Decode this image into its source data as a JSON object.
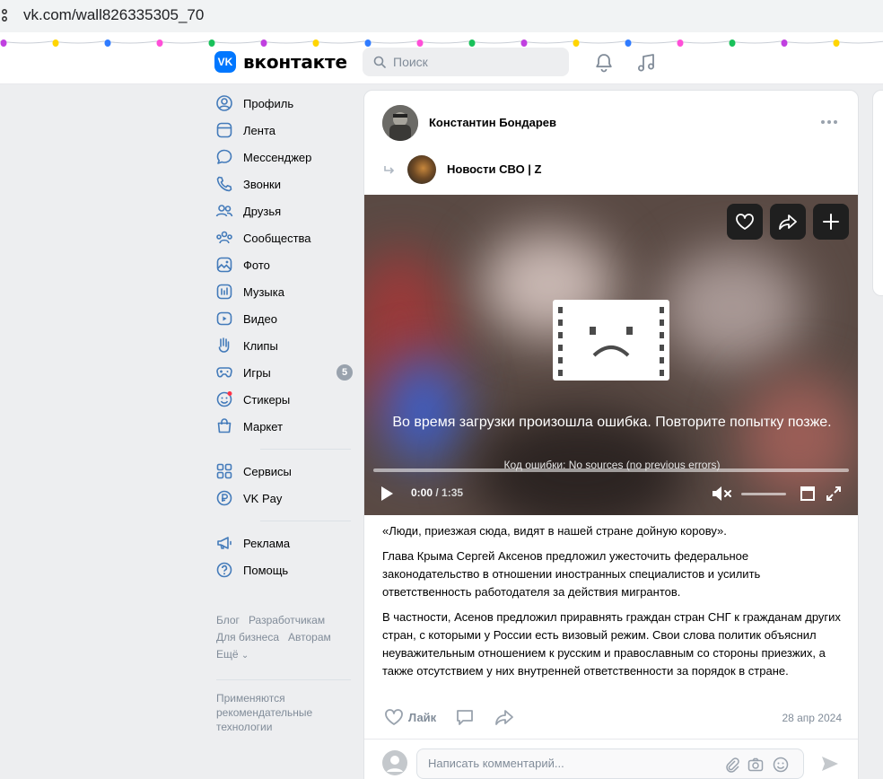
{
  "browser": {
    "url": "vk.com/wall826335305_70"
  },
  "header": {
    "logo_mark": "VK",
    "logo_text": "вконтакте",
    "search_placeholder": "Поиск"
  },
  "sidebar": {
    "items": [
      {
        "label": "Профиль",
        "icon": "profile-icon"
      },
      {
        "label": "Лента",
        "icon": "news-icon"
      },
      {
        "label": "Мессенджер",
        "icon": "message-icon"
      },
      {
        "label": "Звонки",
        "icon": "phone-icon"
      },
      {
        "label": "Друзья",
        "icon": "friends-icon"
      },
      {
        "label": "Сообщества",
        "icon": "communities-icon"
      },
      {
        "label": "Фото",
        "icon": "photo-icon"
      },
      {
        "label": "Музыка",
        "icon": "music-icon"
      },
      {
        "label": "Видео",
        "icon": "video-icon"
      },
      {
        "label": "Клипы",
        "icon": "clips-icon"
      },
      {
        "label": "Игры",
        "icon": "games-icon",
        "badge": "5"
      },
      {
        "label": "Стикеры",
        "icon": "stickers-icon"
      },
      {
        "label": "Маркет",
        "icon": "market-icon"
      },
      {
        "label": "Сервисы",
        "icon": "services-icon"
      },
      {
        "label": "VK Pay",
        "icon": "vkpay-icon"
      },
      {
        "label": "Реклама",
        "icon": "ads-icon"
      },
      {
        "label": "Помощь",
        "icon": "help-icon"
      }
    ],
    "footer_links": [
      "Блог",
      "Разработчикам",
      "Для бизнеса",
      "Авторам",
      "Ещё"
    ],
    "recommendation_note": "Применяются рекомендательные технологии"
  },
  "post": {
    "author": "Константин Бондарев",
    "source": "Новости СВО | Z",
    "video": {
      "error_message": "Во время загрузки произошла ошибка. Повторите попытку позже.",
      "error_code": "Код ошибки: No sources (no previous errors)",
      "current_time": "0:00",
      "duration": "/ 1:35"
    },
    "paragraphs": [
      "«Люди, приезжая сюда, видят в нашей стране дойную корову».",
      "Глава Крыма Сергей Аксенов предложил ужесточить федеральное законодательство в отношении иностранных специалистов и усилить ответственность работодателя за действия мигрантов.",
      "В частности, Асенов предложил приравнять граждан стран СНГ к гражданам других стран, с которыми у России есть визовый режим. Свои слова политик объяснил неуважительным отношением к русским и православным со стороны приезжих, а также отсутствием у них внутренней ответственности за порядок в стране."
    ],
    "like_label": "Лайк",
    "date": "28 апр 2024",
    "comment_placeholder": "Написать комментарий..."
  },
  "colors": {
    "accent": "#0077ff",
    "muted": "#818c99",
    "page_bg": "#edeef0"
  }
}
